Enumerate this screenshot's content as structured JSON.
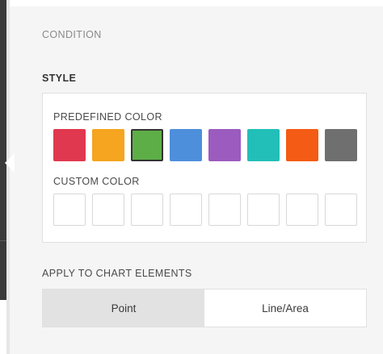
{
  "panel": {
    "condition_label": "CONDITION",
    "style_label": "STYLE"
  },
  "style": {
    "predefined_label": "PREDEFINED COLOR",
    "predefined_colors": [
      {
        "name": "red",
        "hex": "#e0384e"
      },
      {
        "name": "orange",
        "hex": "#f5a51f"
      },
      {
        "name": "green",
        "hex": "#5dae47",
        "selected": true
      },
      {
        "name": "blue",
        "hex": "#4e8fdc"
      },
      {
        "name": "purple",
        "hex": "#9b5bbf"
      },
      {
        "name": "teal",
        "hex": "#22bfb8"
      },
      {
        "name": "deep-orange",
        "hex": "#f45b14"
      },
      {
        "name": "gray",
        "hex": "#6f6f6f"
      }
    ],
    "custom_label": "CUSTOM COLOR",
    "custom_slots": 8
  },
  "apply": {
    "label": "APPLY TO CHART ELEMENTS",
    "options": [
      "Point",
      "Line/Area"
    ],
    "selected": "Point"
  }
}
